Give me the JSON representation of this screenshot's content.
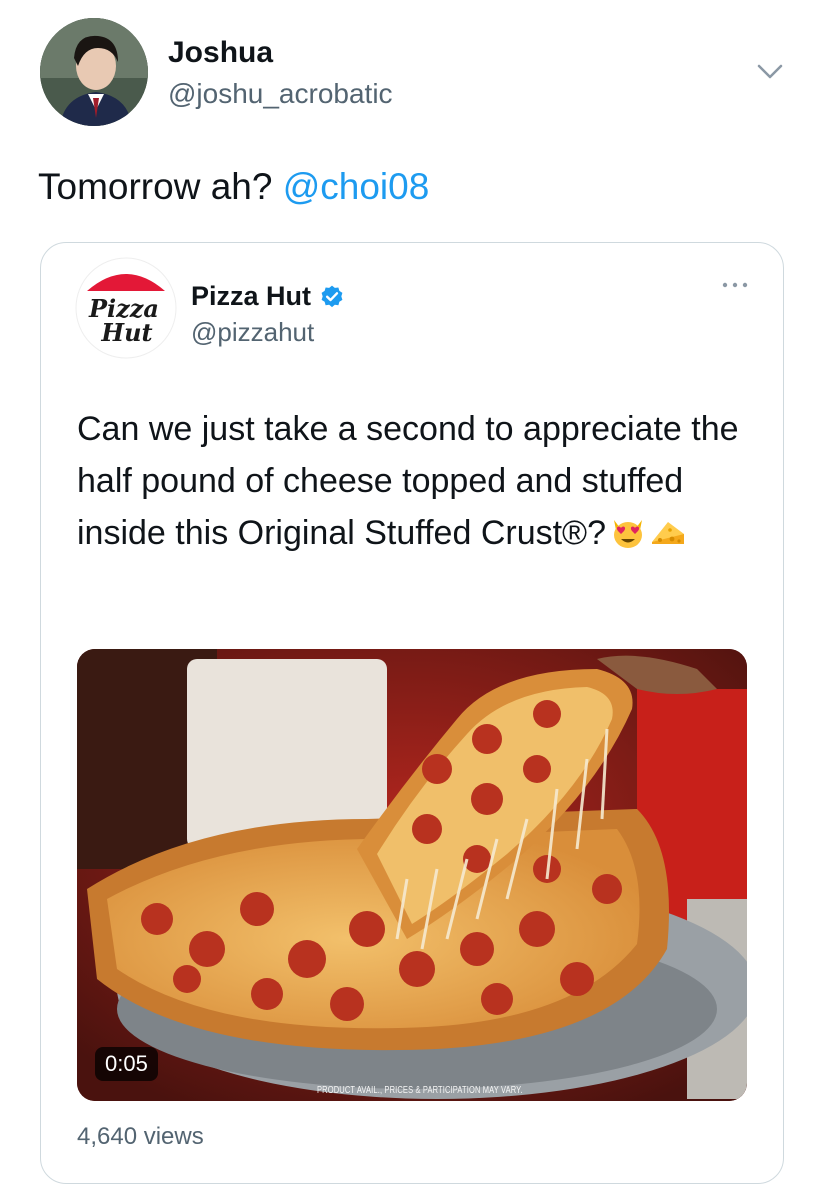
{
  "tweet": {
    "author_name": "Joshua",
    "author_handle": "@joshu_acrobatic",
    "text": "Tomorrow ah? ",
    "mention": "@choi08"
  },
  "quote": {
    "author_name": "Pizza Hut",
    "author_handle": "@pizzahut",
    "logo_text_top": "Pizza",
    "logo_text_bottom": "Hut",
    "text": "Can we just take a second to appreciate the half pound of cheese topped and stuffed inside this Original Stuffed Crust®?",
    "emojis": [
      "heart-eyes-cat-icon",
      "cheese-icon"
    ],
    "media": {
      "duration": "0:05",
      "disclaimer": "PRODUCT AVAIL., PRICES & PARTICIPATION MAY VARY."
    },
    "views": "4,640 views"
  },
  "colors": {
    "link": "#1d9bf0",
    "secondary_text": "#536471",
    "border": "#cfd9de",
    "brand_red": "#e31837"
  }
}
